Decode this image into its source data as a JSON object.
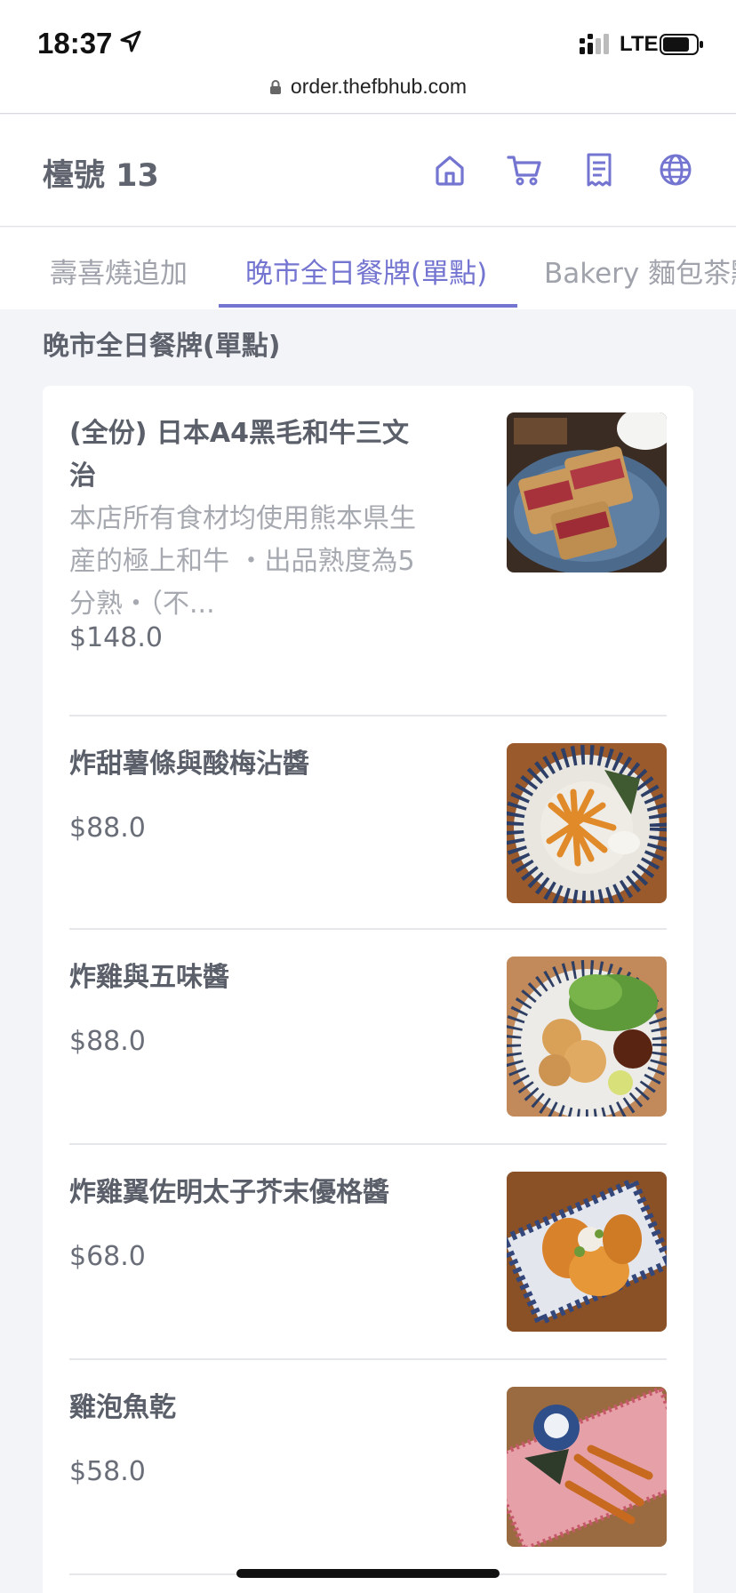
{
  "status_bar": {
    "time": "18:37",
    "network": "LTE"
  },
  "browser": {
    "url": "order.thefbhub.com"
  },
  "header": {
    "table_label": "檯號 13",
    "icons": [
      "home-icon",
      "cart-icon",
      "receipt-icon",
      "globe-icon"
    ],
    "accent_color": "#7475d1"
  },
  "tabs": [
    {
      "label": "壽喜燒追加",
      "active": false
    },
    {
      "label": "晚市全日餐牌(單點)",
      "active": true
    },
    {
      "label": "Bakery 麵包茶點",
      "active": false
    }
  ],
  "section": {
    "title": "晚市全日餐牌(單點)"
  },
  "items": [
    {
      "name": "(全份) 日本A4黑毛和牛三文治",
      "description": "本店所有食材均使用熊本県生産的極上和牛 ・出品熟度為5分熟・（不...",
      "price": "$148.0"
    },
    {
      "name": "炸甜薯條與酸梅沾醬",
      "price": "$88.0"
    },
    {
      "name": "炸雞與五味醬",
      "price": "$88.0"
    },
    {
      "name": "炸雞翼佐明太子芥末優格醬",
      "price": "$68.0"
    },
    {
      "name": "雞泡魚乾",
      "price": "$58.0"
    }
  ]
}
